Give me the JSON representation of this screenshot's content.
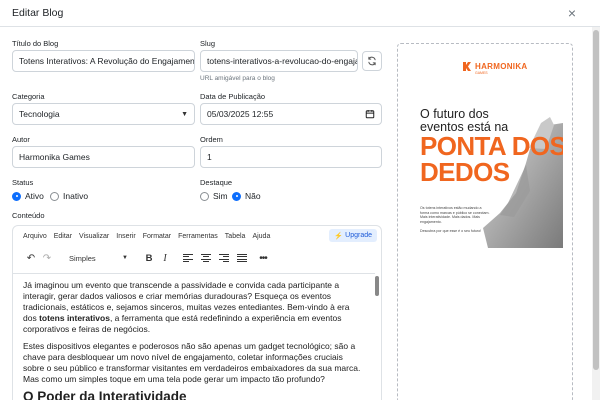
{
  "modal": {
    "title": "Editar Blog",
    "close_symbol": "×"
  },
  "form": {
    "title_label": "Título do Blog",
    "title_value": "Totens Interativos: A Revolução do Engajamento",
    "slug_label": "Slug",
    "slug_value": "totens-interativos-a-revolucao-do-engajamento",
    "slug_help": "URL amigável para o blog",
    "category_label": "Categoria",
    "category_value": "Tecnologia",
    "date_label": "Data de Publicação",
    "date_value": "05/03/2025 12:55",
    "author_label": "Autor",
    "author_value": "Harmonika Games",
    "order_label": "Ordem",
    "order_value": "1",
    "status_label": "Status",
    "status_options": [
      {
        "label": "Ativo",
        "selected": true
      },
      {
        "label": "Inativo",
        "selected": false
      }
    ],
    "featured_label": "Destaque",
    "featured_options": [
      {
        "label": "Sim",
        "selected": false
      },
      {
        "label": "Não",
        "selected": true
      }
    ],
    "content_label": "Conteúdo"
  },
  "editor": {
    "menu": [
      "Arquivo",
      "Editar",
      "Visualizar",
      "Inserir",
      "Formatar",
      "Ferramentas",
      "Tabela",
      "Ajuda"
    ],
    "upgrade_label": "Upgrade",
    "style_value": "Simples",
    "bold_label": "B",
    "italic_label": "I",
    "p1_before": "Já imaginou um evento que transcende a passividade e convida cada participante a interagir, gerar dados valiosos e criar memórias duradouras? Esqueça os eventos tradicionais, estáticos e, sejamos sinceros, muitas vezes entediantes. Bem-vindo à era dos ",
    "p1_bold": "totens interativos",
    "p1_after": ", a ferramenta que está redefinindo a experiência em eventos corporativos e feiras de negócios.",
    "p2": "Estes dispositivos elegantes e poderosos não são apenas um gadget tecnológico; são a chave para desbloquear um novo nível de engajamento, coletar informações cruciais sobre o seu público e transformar visitantes em verdadeiros embaixadores da sua marca. Mas como um simples toque em uma tela pode gerar um impacto tão profundo?",
    "h2": "O Poder da Interatividade"
  },
  "poster": {
    "brand": "HARMONIKA",
    "brand_sub": "GAMES",
    "line1": "O futuro dos",
    "line2": "eventos está na",
    "big1": "PONTA DOS",
    "big2": "DEDOS",
    "small": "Os totens interativos estão mudando a forma como marcas e público se conectam. Mais interatividade. Mais dados. Mais engajamento.",
    "small2": "Descubra por que esse é o seu futuro!",
    "accent": "#f0661f"
  }
}
